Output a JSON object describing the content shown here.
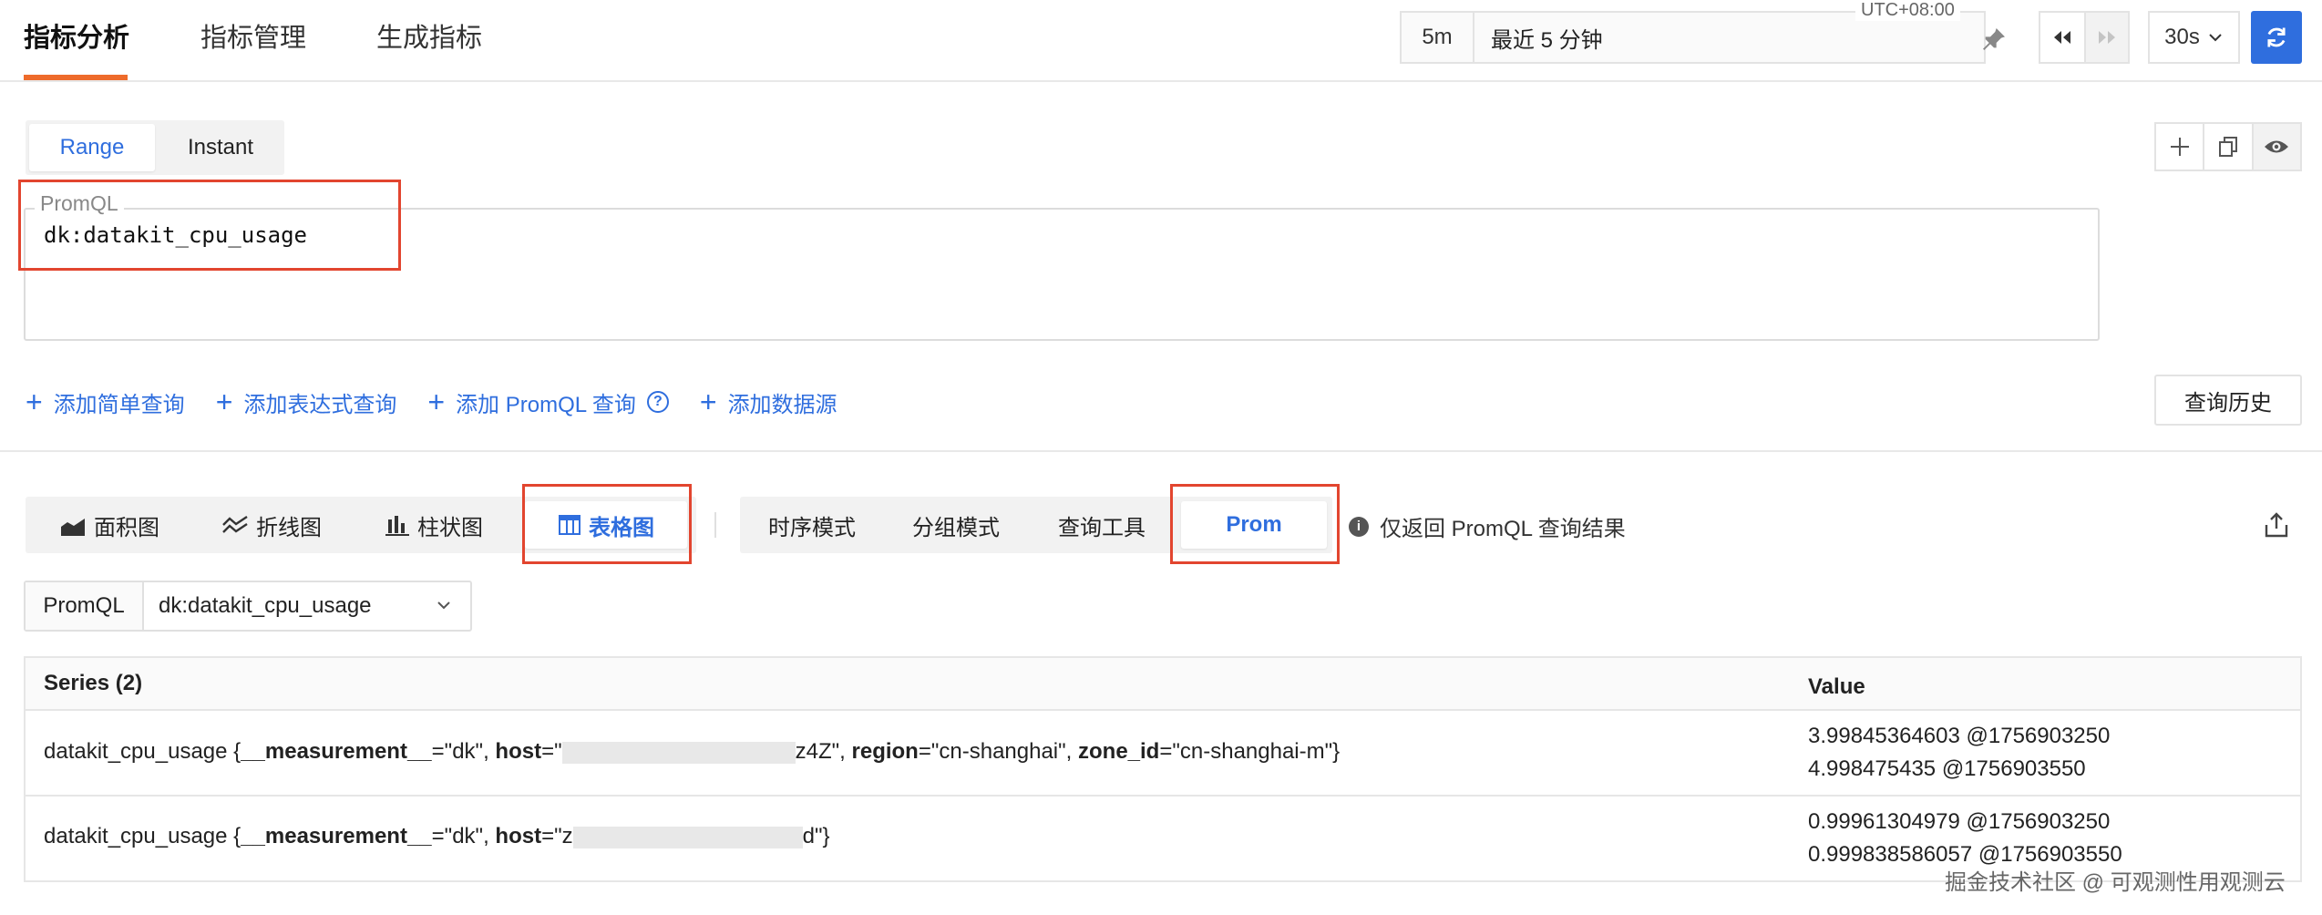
{
  "top_tabs": [
    {
      "label": "指标分析",
      "active": true
    },
    {
      "label": "指标管理",
      "active": false
    },
    {
      "label": "生成指标",
      "active": false
    }
  ],
  "time": {
    "quick": "5m",
    "description": "最近 5 分钟",
    "timezone": "UTC+08:00",
    "refresh_interval": "30s"
  },
  "query_mode": {
    "options": [
      "Range",
      "Instant"
    ],
    "selected": "Range"
  },
  "promql_editor": {
    "label": "PromQL",
    "value": "dk:datakit_cpu_usage"
  },
  "add_actions": [
    "添加简单查询",
    "添加表达式查询",
    "添加 PromQL 查询",
    "添加数据源"
  ],
  "history_button": "查询历史",
  "chart_types": [
    {
      "label": "面积图",
      "icon": "area-chart-icon",
      "active": false
    },
    {
      "label": "折线图",
      "icon": "line-chart-icon",
      "active": false
    },
    {
      "label": "柱状图",
      "icon": "bar-chart-icon",
      "active": false
    },
    {
      "label": "表格图",
      "icon": "table-chart-icon",
      "active": true
    }
  ],
  "view_modes": [
    {
      "label": "时序模式",
      "active": false
    },
    {
      "label": "分组模式",
      "active": false
    },
    {
      "label": "查询工具",
      "active": false
    },
    {
      "label": "Prom",
      "active": true
    }
  ],
  "info_note": "仅返回 PromQL 查询结果",
  "query_select": {
    "prefix": "PromQL",
    "value": "dk:datakit_cpu_usage"
  },
  "table": {
    "headers": {
      "series": "Series (2)",
      "value": "Value"
    },
    "rows": [
      {
        "metric": "datakit_cpu_usage",
        "label_1_key": "__measurement__",
        "label_1_val": "\"dk\"",
        "label_2_key": "host",
        "label_2_start": "\"",
        "label_2_end": "z4Z\"",
        "label_3_key": "region",
        "label_3_val": "\"cn-shanghai\"",
        "label_4_key": "zone_id",
        "label_4_val": "\"cn-shanghai-m\"",
        "values": [
          "3.99845364603 @1756903250",
          "4.998475435 @1756903550"
        ]
      },
      {
        "metric": "datakit_cpu_usage",
        "label_1_key": "__measurement__",
        "label_1_val": "\"dk\"",
        "label_2_key": "host",
        "label_2_start": "\"z",
        "label_2_end": "d\"",
        "values": [
          "0.99961304979 @1756903250",
          "0.999838586057 @1756903550"
        ]
      }
    ]
  },
  "watermark": "掘金技术社区 @ 可观测性用观测云",
  "colors": {
    "accent": "#2f6ede",
    "tab_underline": "#ee6b2b",
    "highlight": "#e2452f"
  }
}
